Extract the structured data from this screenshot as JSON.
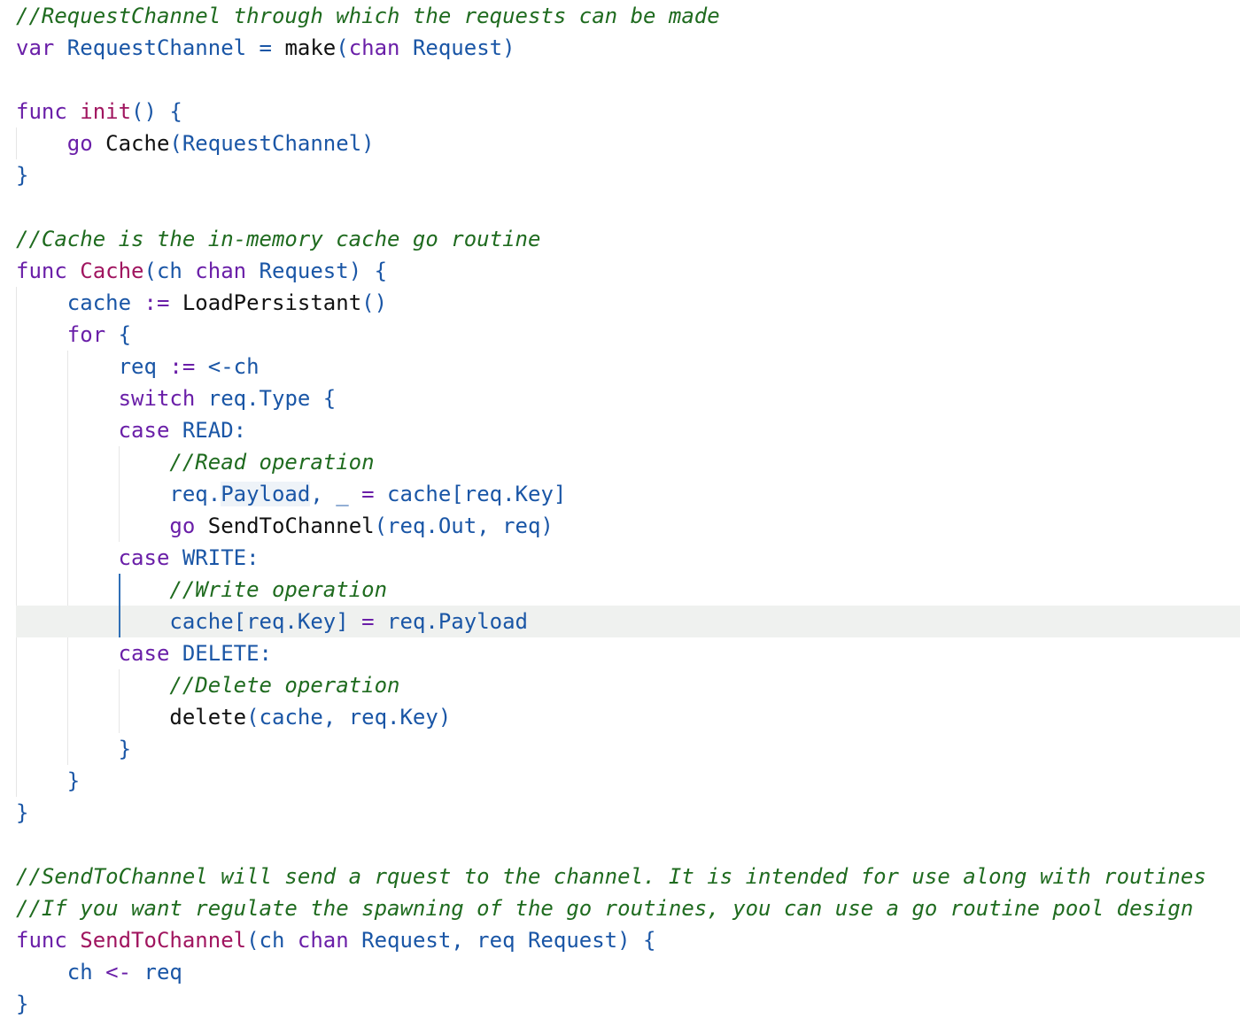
{
  "editor": {
    "lines": [
      [
        {
          "t": "//RequestChannel through which the requests can be made",
          "c": "comment"
        }
      ],
      [
        {
          "t": "var ",
          "c": "kw"
        },
        {
          "t": "RequestChannel",
          "c": "id"
        },
        {
          "t": " = ",
          "c": "punc"
        },
        {
          "t": "make",
          "c": "call"
        },
        {
          "t": "(",
          "c": "punc"
        },
        {
          "t": "chan ",
          "c": "kw"
        },
        {
          "t": "Request",
          "c": "id"
        },
        {
          "t": ")",
          "c": "punc"
        }
      ],
      [],
      [
        {
          "t": "func ",
          "c": "kw"
        },
        {
          "t": "init",
          "c": "fn"
        },
        {
          "t": "() {",
          "c": "punc"
        }
      ],
      [
        {
          "t": "    "
        },
        {
          "t": "go ",
          "c": "kw"
        },
        {
          "t": "Cache",
          "c": "call"
        },
        {
          "t": "(RequestChannel)",
          "c": "punc"
        }
      ],
      [
        {
          "t": "}",
          "c": "punc"
        }
      ],
      [],
      [
        {
          "t": "//Cache is the in-memory cache go routine",
          "c": "comment"
        }
      ],
      [
        {
          "t": "func ",
          "c": "kw"
        },
        {
          "t": "Cache",
          "c": "fn"
        },
        {
          "t": "(ch ",
          "c": "punc"
        },
        {
          "t": "chan ",
          "c": "kw"
        },
        {
          "t": "Request) {",
          "c": "punc"
        }
      ],
      [
        {
          "t": "    "
        },
        {
          "t": "cache ",
          "c": "id"
        },
        {
          "t": ":= ",
          "c": "kw"
        },
        {
          "t": "LoadPersistant",
          "c": "call"
        },
        {
          "t": "()",
          "c": "punc"
        }
      ],
      [
        {
          "t": "    "
        },
        {
          "t": "for ",
          "c": "kw"
        },
        {
          "t": "{",
          "c": "punc"
        }
      ],
      [
        {
          "t": "        "
        },
        {
          "t": "req ",
          "c": "id"
        },
        {
          "t": ":= ",
          "c": "kw"
        },
        {
          "t": "<-ch",
          "c": "id"
        }
      ],
      [
        {
          "t": "        "
        },
        {
          "t": "switch ",
          "c": "kw"
        },
        {
          "t": "req.Type {",
          "c": "id"
        }
      ],
      [
        {
          "t": "        "
        },
        {
          "t": "case ",
          "c": "kw"
        },
        {
          "t": "READ:",
          "c": "id"
        }
      ],
      [
        {
          "t": "            "
        },
        {
          "t": "//Read operation",
          "c": "comment"
        }
      ],
      [
        {
          "t": "            "
        },
        {
          "t": "req.",
          "c": "id"
        },
        {
          "t": "Payload",
          "c": "id",
          "hl": true
        },
        {
          "t": ", _ ",
          "c": "id"
        },
        {
          "t": "= ",
          "c": "kw"
        },
        {
          "t": "cache[req.Key]",
          "c": "id"
        }
      ],
      [
        {
          "t": "            "
        },
        {
          "t": "go ",
          "c": "kw"
        },
        {
          "t": "SendToChannel",
          "c": "call"
        },
        {
          "t": "(req.Out, req)",
          "c": "punc"
        }
      ],
      [
        {
          "t": "        "
        },
        {
          "t": "case ",
          "c": "kw"
        },
        {
          "t": "WRITE:",
          "c": "id"
        }
      ],
      [
        {
          "t": "            "
        },
        {
          "t": "//Write operation",
          "c": "comment"
        }
      ],
      [
        {
          "t": "            "
        },
        {
          "t": "cache[req.Key] ",
          "c": "id"
        },
        {
          "t": "= ",
          "c": "kw"
        },
        {
          "t": "req.Payload",
          "c": "id"
        }
      ],
      [
        {
          "t": "        "
        },
        {
          "t": "case ",
          "c": "kw"
        },
        {
          "t": "DELETE:",
          "c": "id"
        }
      ],
      [
        {
          "t": "            "
        },
        {
          "t": "//Delete operation",
          "c": "comment"
        }
      ],
      [
        {
          "t": "            "
        },
        {
          "t": "delete",
          "c": "call"
        },
        {
          "t": "(cache, req.Key)",
          "c": "punc"
        }
      ],
      [
        {
          "t": "        "
        },
        {
          "t": "}",
          "c": "punc"
        }
      ],
      [
        {
          "t": "    "
        },
        {
          "t": "}",
          "c": "punc"
        }
      ],
      [
        {
          "t": "}",
          "c": "punc"
        }
      ],
      [],
      [
        {
          "t": "//SendToChannel will send a rquest to the channel. It is intended for use along with routines",
          "c": "comment"
        }
      ],
      [
        {
          "t": "//If you want regulate the spawning of the go routines, you can use a go routine pool design",
          "c": "comment"
        }
      ],
      [
        {
          "t": "func ",
          "c": "kw"
        },
        {
          "t": "SendToChannel",
          "c": "fn"
        },
        {
          "t": "(ch ",
          "c": "punc"
        },
        {
          "t": "chan ",
          "c": "kw"
        },
        {
          "t": "Request, req Request) {",
          "c": "punc"
        }
      ],
      [
        {
          "t": "    "
        },
        {
          "t": "ch ",
          "c": "id"
        },
        {
          "t": "<- ",
          "c": "kw"
        },
        {
          "t": "req",
          "c": "id"
        }
      ],
      [
        {
          "t": "}",
          "c": "punc"
        }
      ]
    ],
    "current_line": 19
  }
}
